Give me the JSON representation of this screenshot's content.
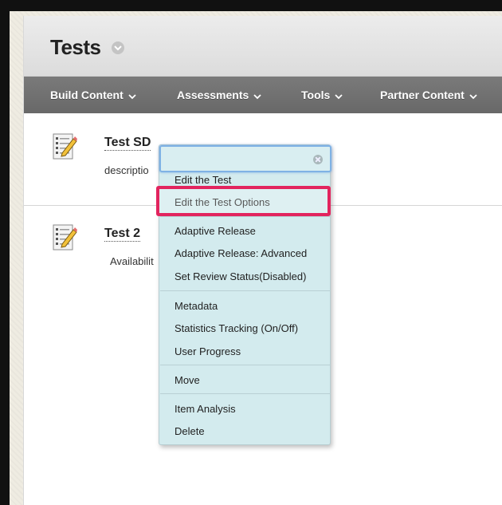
{
  "header": {
    "title": "Tests"
  },
  "nav": {
    "items": [
      {
        "label": "Build Content"
      },
      {
        "label": "Assessments"
      },
      {
        "label": "Tools"
      },
      {
        "label": "Partner Content"
      }
    ]
  },
  "items": [
    {
      "title": "Test SD",
      "description": "descriptio"
    },
    {
      "title": "Test 2",
      "description": "Availabilit"
    }
  ],
  "context_menu": {
    "search_value": "",
    "groups": [
      [
        "Edit the Test",
        "Edit the Test Options"
      ],
      [
        "Adaptive Release",
        "Adaptive Release: Advanced",
        "Set Review Status(Disabled)"
      ],
      [
        "Metadata",
        "Statistics Tracking (On/Off)",
        "User Progress"
      ],
      [
        "Move"
      ],
      [
        "Item Analysis",
        "Delete"
      ]
    ],
    "highlighted": "Edit the Test Options"
  },
  "colors": {
    "highlight": "#e2245e",
    "menu_bg": "#d3ebee",
    "nav_bg": "#6f6f6f"
  }
}
